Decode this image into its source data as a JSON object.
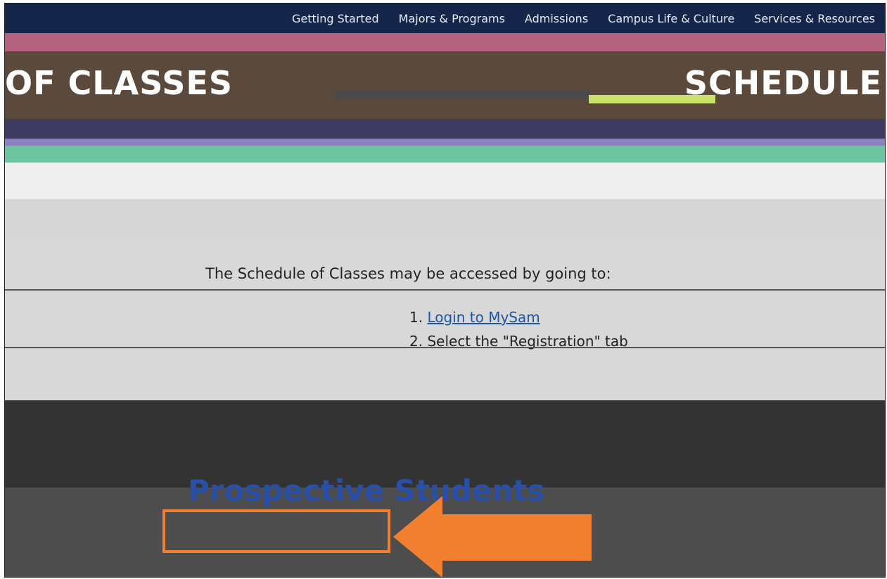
{
  "nav": {
    "items": [
      "Getting Started",
      "Majors & Programs",
      "Admissions",
      "Campus Life & Culture",
      "Services & Resources"
    ]
  },
  "hero": {
    "left_text": "OF CLASSES",
    "right_text": "SCHEDULE"
  },
  "content": {
    "intro": "The Schedule of Classes may be accessed by going to:",
    "steps": [
      "Login to MySam",
      "Select the \"Registration\" tab"
    ]
  },
  "sections": {
    "prospective": "Prospective Students"
  },
  "annotation": {
    "color": "#f08030"
  },
  "colors": {
    "nav_bg": "#14274a",
    "link": "#1a55a8",
    "heading": "#1f4a86"
  }
}
